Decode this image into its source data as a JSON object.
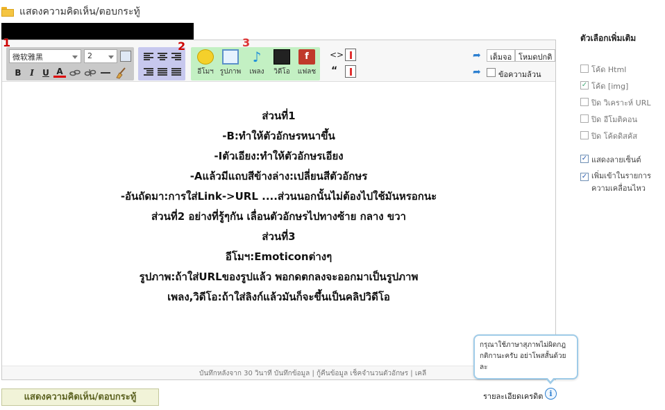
{
  "header": {
    "title": "แสดงความคิดเห็น/ตอบกระทู้"
  },
  "toolbar": {
    "font_family": "微软雅黑",
    "font_size": "2",
    "format": {
      "bold": "B",
      "italic": "I",
      "underline": "U",
      "font_color": "A"
    },
    "markers": [
      "1",
      "2",
      "3"
    ],
    "media": [
      {
        "label": "อีโมฯ",
        "icon": "emoticon-icon"
      },
      {
        "label": "รูปภาพ",
        "icon": "image-icon"
      },
      {
        "label": "เพลง",
        "icon": "music-icon"
      },
      {
        "label": "วิดีโอ",
        "icon": "video-icon"
      },
      {
        "label": "แฟลช",
        "icon": "flash-icon"
      }
    ],
    "code_symbol": "<>",
    "quote_symbol": "“",
    "fullscreen_label": "เต็มจอ",
    "normal_mode_label": "โหมดปกติ",
    "plaintext_label": "ข้อความล้วน"
  },
  "content": {
    "lines": [
      "ส่วนที่1",
      "-B:ทำให้ตัวอักษรหนาขึ้น",
      "-Iตัวเอียง:ทำให้ตัวอักษรเอียง",
      "-Aแล้วมีแถบสีข้างล่าง:เปลี่ยนสีตัวอักษร",
      "-อันถัดมา:การใส่Link->URL ....ส่วนนอกนั้นไม่ต้องไปใช้มันหรอกนะ",
      "ส่วนที่2 อย่างที่รู้ๆกัน เลื่อนตัวอักษรไปทางซ้าย กลาง ขวา",
      "ส่วนที่3",
      "อีโมฯ:Emoticonต่างๆ",
      "รูปภาพ:ถ้าใส่URLของรูปแล้ว พอกดตกลงจะออกมาเป็นรูปภาพ",
      "เพลง,วิดีโอ:ถ้าใส่ลิงก์แล้วมันก็จะขึ้นเป็นคลิปวิดีโอ"
    ]
  },
  "status_bar": {
    "text": "บันทึกหลังจาก 30 วินาที บันทึกข้อมูล | กู้คืนข้อมูล     เช็คจำนวนตัวอักษร | เคลี"
  },
  "sidebar": {
    "title": "ตัวเลือกเพิ่มเติม",
    "options": [
      {
        "label": "โค้ด Html",
        "checked": false
      },
      {
        "label": "โค้ด [img]",
        "checked": true
      },
      {
        "label": "ปิด วิเคราะห์ URL",
        "checked": false
      },
      {
        "label": "ปิด อีโมติคอน",
        "checked": false
      },
      {
        "label": "ปิด โค้ดดิสคัส",
        "checked": false
      },
      {
        "label": "แสดงลายเซ็นต์",
        "checked": true
      },
      {
        "label": "เพิ่มเข้าในรายการความเคลื่อนไหว",
        "checked": true
      }
    ]
  },
  "tooltip": {
    "text": "กรุณาใช้ภาษาสุภาพไม่ผิดกฎกติกานะครับ อย่าโพสสั้นด้วยละ"
  },
  "credit_label": "รายละเอียดเครดิต",
  "info_symbol": "i",
  "submit": {
    "label": "แสดงความคิดเห็น/ตอบกระทู้"
  },
  "colors": {
    "group_font": "#c9c9c9",
    "group_align": "#c7c8ee",
    "group_media": "#c3f0c3",
    "marker": "#cc0000",
    "accent": "#2c7fd0"
  }
}
